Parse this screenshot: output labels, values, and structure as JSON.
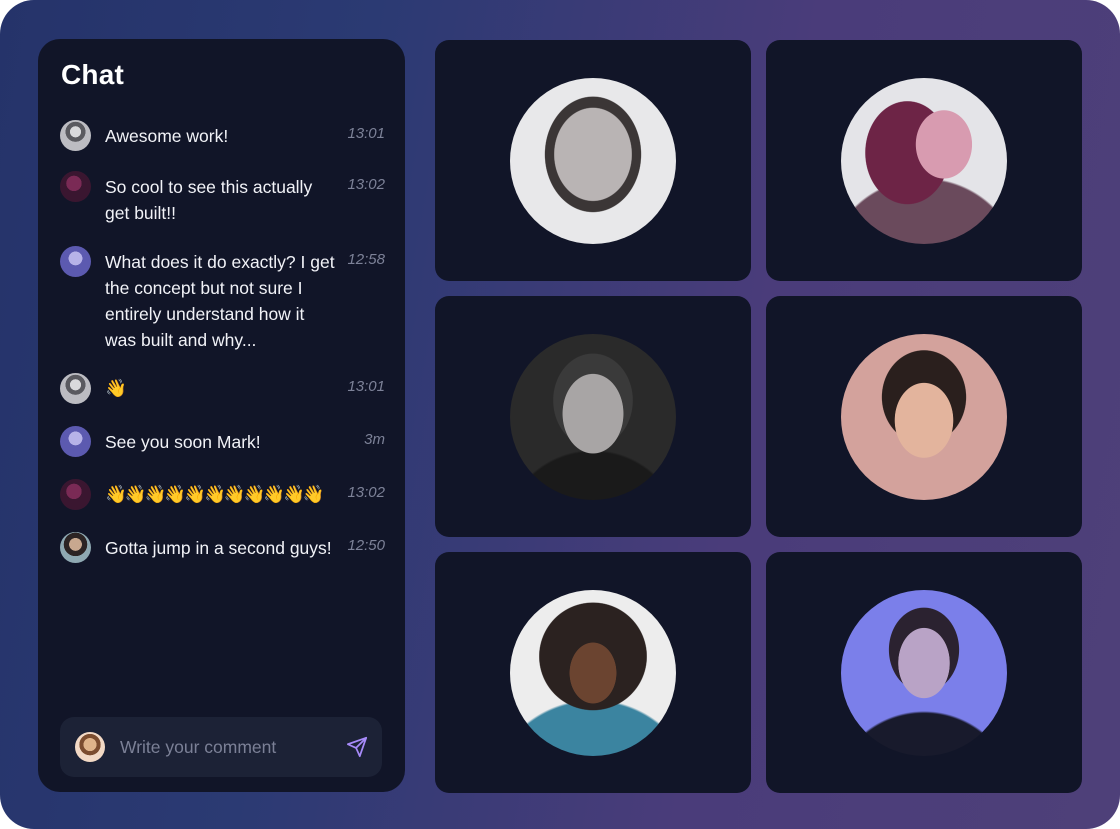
{
  "chat": {
    "title": "Chat",
    "messages": [
      {
        "avatar": "avatar-man-smiling",
        "text": "Awesome work!",
        "time": "13:01"
      },
      {
        "avatar": "avatar-woman-pink",
        "text": "So cool to see this actually get built!!",
        "time": "13:02"
      },
      {
        "avatar": "avatar-man-purple",
        "text": "What does it do exactly? I get the concept but not sure I entirely understand how it was built and why...",
        "time": "12:58"
      },
      {
        "avatar": "avatar-man-smiling",
        "text": "👋",
        "time": "13:01"
      },
      {
        "avatar": "avatar-man-purple",
        "text": "See you soon Mark!",
        "time": "3m"
      },
      {
        "avatar": "avatar-woman-pink",
        "text": "👋👋👋👋👋👋👋👋👋👋👋",
        "time": "13:02"
      },
      {
        "avatar": "avatar-woman-glasses",
        "text": "Gotta jump in a second guys!",
        "time": "12:50"
      }
    ],
    "composer": {
      "placeholder": "Write your comment",
      "avatar": "avatar-man-beard",
      "send_icon": "send-icon"
    }
  },
  "participants": [
    {
      "name": "participant-1",
      "portrait": "man smiling grayscale"
    },
    {
      "name": "participant-2",
      "portrait": "woman pink light profile"
    },
    {
      "name": "participant-3",
      "portrait": "woman black and white"
    },
    {
      "name": "participant-4",
      "portrait": "woman pink background"
    },
    {
      "name": "participant-5",
      "portrait": "man curly hair sunglasses"
    },
    {
      "name": "participant-6",
      "portrait": "woman blue light"
    }
  ],
  "colors": {
    "panel": "#111528",
    "composer": "#1c2236",
    "accent": "#a78bfa",
    "time": "#7d8298"
  }
}
